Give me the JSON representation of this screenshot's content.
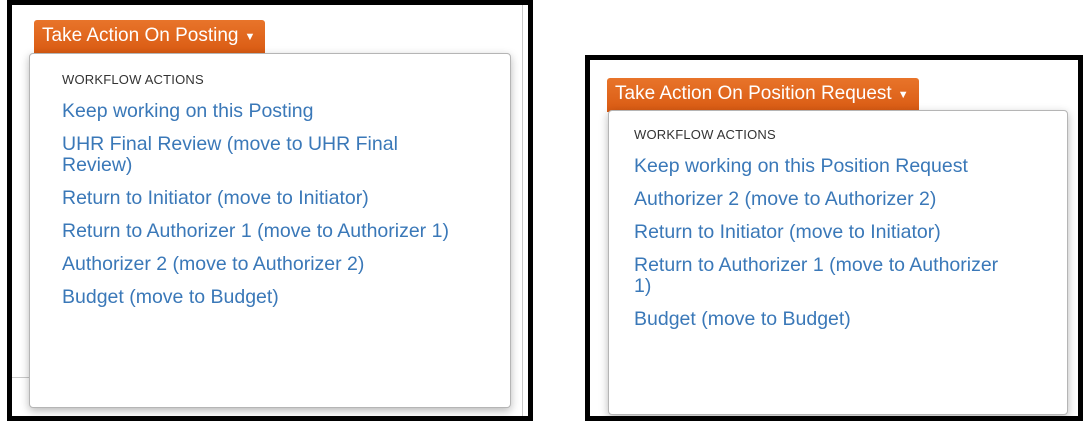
{
  "left": {
    "button_label": "Take Action On Posting",
    "caret": "▼",
    "heading": "WORKFLOW ACTIONS",
    "items": [
      "Keep working on this Posting",
      "UHR Final Review (move to UHR Final Review)",
      "Return to Initiator (move to Initiator)",
      "Return to Authorizer 1 (move to Authorizer 1)",
      "Authorizer 2 (move to Authorizer 2)",
      "Budget (move to Budget)"
    ]
  },
  "right": {
    "button_label": "Take Action On Position Request",
    "caret": "▼",
    "heading": "WORKFLOW ACTIONS",
    "items": [
      "Keep working on this Position Request",
      "Authorizer 2 (move to Authorizer 2)",
      "Return to Initiator (move to Initiator)",
      "Return to Authorizer 1 (move to Authorizer 1)",
      "Budget (move to Budget)"
    ]
  },
  "colors": {
    "button_bg": "#e0661a",
    "link": "#3a78b8",
    "frame": "#000000"
  }
}
